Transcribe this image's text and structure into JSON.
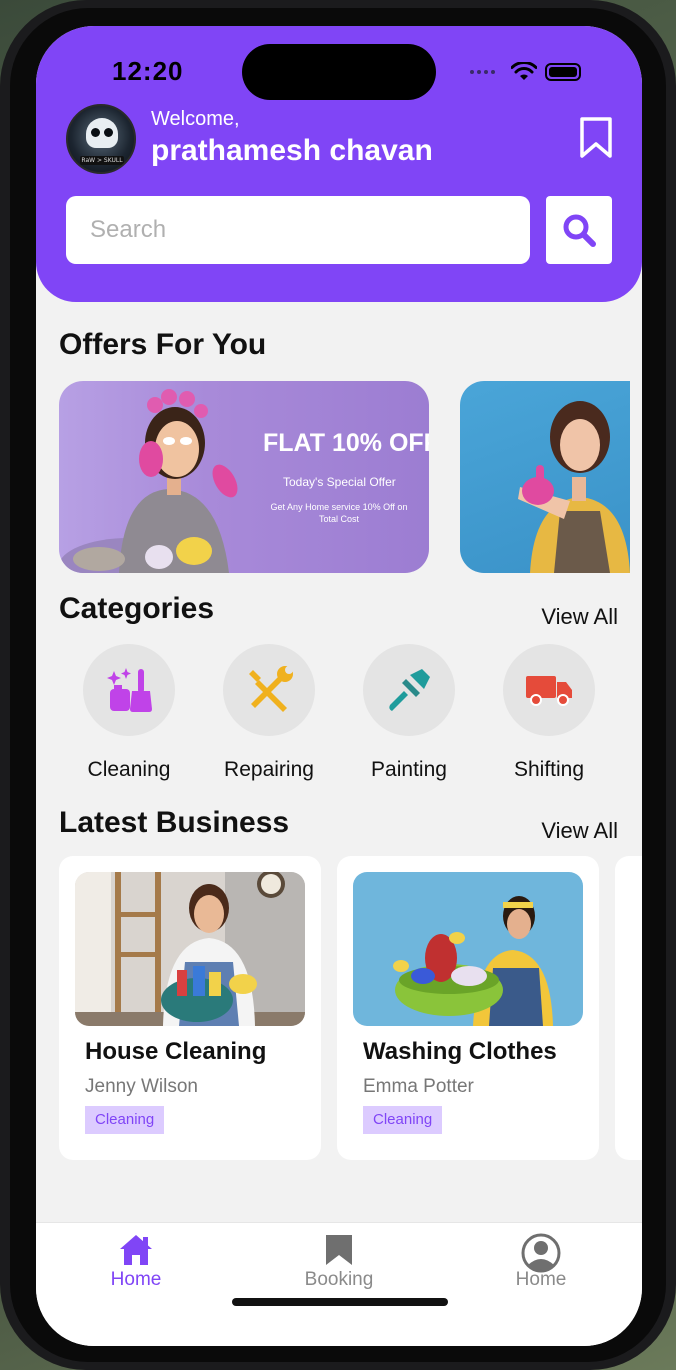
{
  "status_bar": {
    "time": "12:20"
  },
  "header": {
    "welcome": "Welcome,",
    "username": "prathamesh chavan",
    "avatar_text": "RaW > SKULL"
  },
  "search": {
    "placeholder": "Search"
  },
  "offers": {
    "title": "Offers For You",
    "items": [
      {
        "headline": "FLAT 10% OFF",
        "subtitle": "Today's Special Offer",
        "detail": "Get Any Home service 10% Off on Total Cost"
      },
      {
        "headline": "",
        "subtitle": "",
        "detail": ""
      }
    ]
  },
  "categories": {
    "title": "Categories",
    "view_all": "View All",
    "items": [
      {
        "label": "Cleaning",
        "icon": "cleaning-icon",
        "color": "#c043e8"
      },
      {
        "label": "Repairing",
        "icon": "tools-icon",
        "color": "#f0b11e"
      },
      {
        "label": "Painting",
        "icon": "paintbrush-icon",
        "color": "#1f9c9c"
      },
      {
        "label": "Shifting",
        "icon": "truck-icon",
        "color": "#e54b3a"
      }
    ]
  },
  "latest_business": {
    "title": "Latest Business",
    "view_all": "View All",
    "items": [
      {
        "title": "House Cleaning",
        "owner": "Jenny Wilson",
        "tag": "Cleaning"
      },
      {
        "title": "Washing Clothes",
        "owner": "Emma Potter",
        "tag": "Cleaning"
      }
    ]
  },
  "bottom_nav": {
    "items": [
      {
        "label": "Home",
        "icon": "home-icon",
        "active": true
      },
      {
        "label": "Booking",
        "icon": "bookmark-icon",
        "active": false
      },
      {
        "label": "Home",
        "icon": "profile-icon",
        "active": false
      }
    ]
  },
  "colors": {
    "accent": "#8045f6",
    "tag_bg": "#dccbff",
    "inactive": "#8a8a8a"
  }
}
